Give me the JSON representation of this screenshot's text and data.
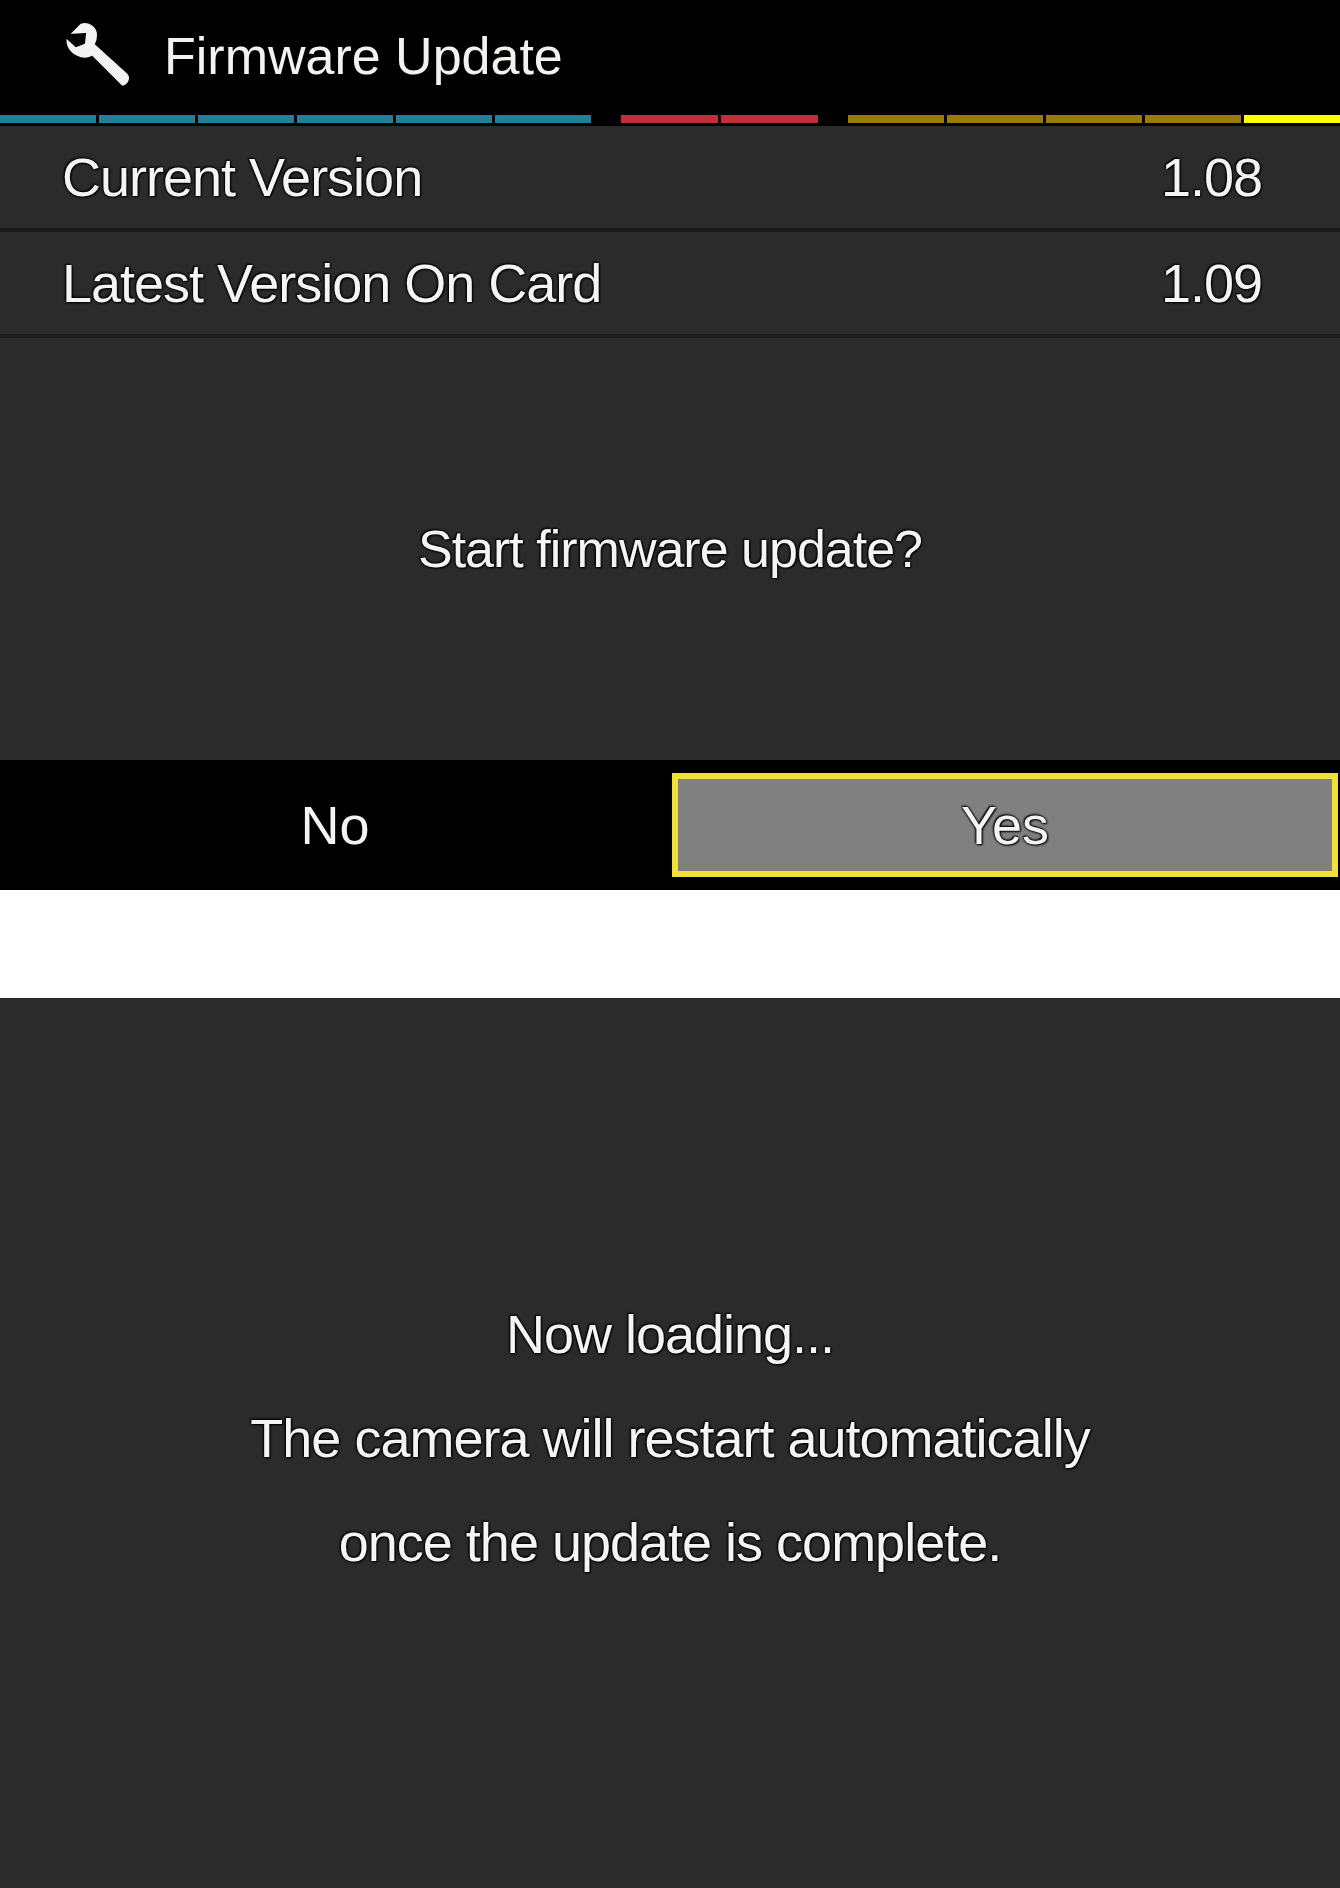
{
  "header": {
    "title": "Firmware Update"
  },
  "tab_groups": [
    {
      "color": "#1f7f9c",
      "tabs": [
        {
          "selected": false
        },
        {
          "selected": false
        },
        {
          "selected": false
        },
        {
          "selected": false
        },
        {
          "selected": false
        },
        {
          "selected": false
        }
      ]
    },
    {
      "color": "#c0303a",
      "tabs": [
        {
          "selected": false
        },
        {
          "selected": false
        }
      ]
    },
    {
      "color": "#9a7a0c",
      "tabs": [
        {
          "selected": false
        },
        {
          "selected": false
        },
        {
          "selected": false
        },
        {
          "selected": false
        },
        {
          "selected": true
        }
      ]
    }
  ],
  "info_rows": [
    {
      "label": "Current Version",
      "value": "1.08"
    },
    {
      "label": "Latest Version On Card",
      "value": "1.09"
    }
  ],
  "prompt": "Start firmware update?",
  "buttons": [
    {
      "label": "No",
      "selected": false
    },
    {
      "label": "Yes",
      "selected": true
    }
  ],
  "loading_screen": {
    "status": "Now loading...",
    "message": "The camera will restart automatically once the update is complete."
  }
}
